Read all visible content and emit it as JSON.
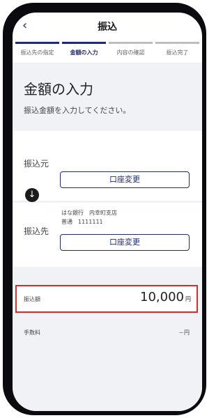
{
  "header": {
    "back_icon": "chevron-left-icon",
    "title": "振込"
  },
  "steps": [
    "振込先の指定",
    "金額の入力",
    "内容の確認",
    "振込完了"
  ],
  "hero": {
    "heading": "金額の入力",
    "subtitle": "振込金額を入力してください。"
  },
  "source": {
    "label": "振込元",
    "change_button": "口座変更"
  },
  "arrow_icon": "arrow-down-icon",
  "destination": {
    "label": "振込先",
    "bank": "はな銀行　内幸町支店",
    "account": "普通　1111111",
    "change_button": "口座変更"
  },
  "amount": {
    "label": "振込額",
    "value": "10,000",
    "unit": "円"
  },
  "fee": {
    "label": "手数料",
    "value": "－円"
  },
  "colors": {
    "accent": "#1f2b6e",
    "highlight_border": "#d32f2f",
    "background_gray": "#f1f2f6"
  }
}
